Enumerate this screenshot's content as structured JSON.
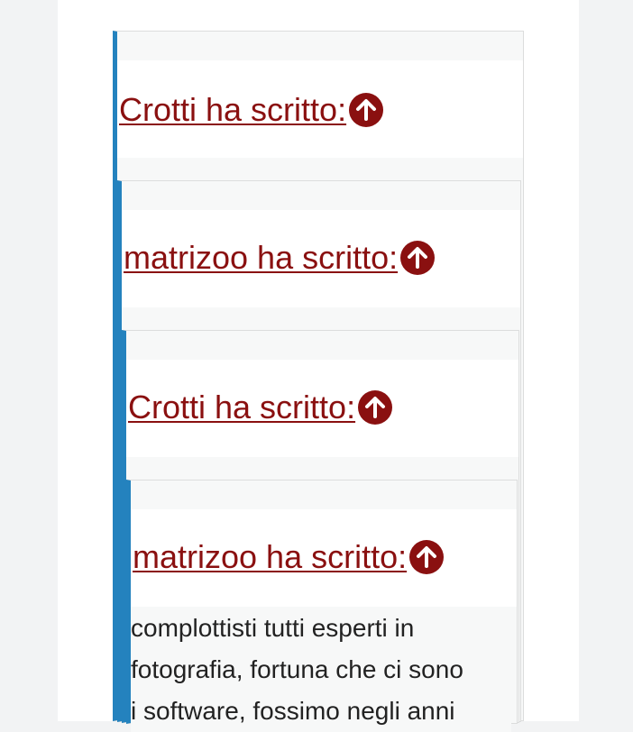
{
  "quotes": [
    {
      "author": "Crotti",
      "label": "Crotti ha scritto:",
      "icon": "arrow-up-circle-icon"
    },
    {
      "author": "matrizoo",
      "label": "matrizoo ha scritto:",
      "icon": "arrow-up-circle-icon"
    },
    {
      "author": "Crotti",
      "label": "Crotti ha scritto:",
      "icon": "arrow-up-circle-icon"
    },
    {
      "author": "matrizoo",
      "label": "matrizoo ha scritto:",
      "icon": "arrow-up-circle-icon"
    }
  ],
  "innermost_text": {
    "line1": "complottisti tutti esperti in",
    "line2": "fotografia, fortuna che ci sono",
    "line3": "i software, fossimo negli anni"
  },
  "colors": {
    "link": "#8a1010",
    "quote_border": "#2482be",
    "quote_bg": "#f7f8f8"
  }
}
